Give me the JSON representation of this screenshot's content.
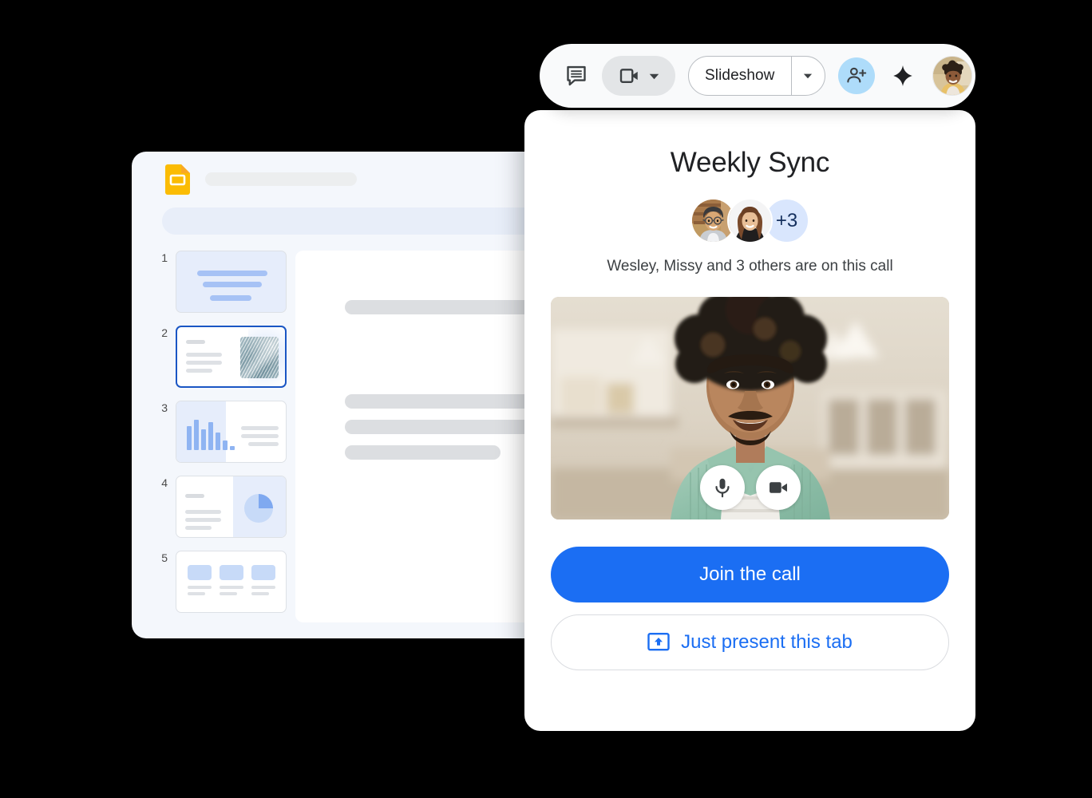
{
  "slides_app": {
    "app_name": "Google Slides",
    "logo_icon": "google-slides-icon",
    "title_placeholder": "",
    "toolbar_placeholder": "",
    "filmstrip": {
      "slides": [
        {
          "number": "1",
          "layout": "title",
          "selected": false
        },
        {
          "number": "2",
          "layout": "text-and-image",
          "selected": true
        },
        {
          "number": "3",
          "layout": "bar-chart-and-text",
          "selected": false
        },
        {
          "number": "4",
          "layout": "text-and-pie-chart",
          "selected": false
        },
        {
          "number": "5",
          "layout": "three-cards",
          "selected": false
        }
      ]
    },
    "canvas": {
      "placeholder_bars": 4
    }
  },
  "meet_toolbar": {
    "chat_icon": "chat-bubble-icon",
    "camera_icon": "video-camera-icon",
    "camera_caret_icon": "chevron-down-icon",
    "slideshow_label": "Slideshow",
    "slideshow_caret_icon": "chevron-down-icon",
    "add_person_icon": "person-add-icon",
    "sparkle_icon": "sparkle-icon",
    "account_avatar": "user-avatar"
  },
  "join_card": {
    "meeting_title": "Weekly Sync",
    "participants": {
      "avatars": [
        "wesley-avatar",
        "missy-avatar"
      ],
      "overflow_count": "+3",
      "summary": "Wesley, Missy and 3 others are on this call"
    },
    "video_preview": {
      "mic_icon": "microphone-icon",
      "camera_icon": "video-camera-icon"
    },
    "join_label": "Join the call",
    "present_label": "Just present this tab",
    "present_icon": "present-to-screen-icon"
  },
  "colors": {
    "primary_blue": "#1B6EF3",
    "slides_yellow": "#FBBC04",
    "avatar_chip_bg": "#D9E6FD",
    "add_person_bg": "#AEDCFA",
    "selected_slide_border": "#1A56C4",
    "page_background": "#000000"
  }
}
